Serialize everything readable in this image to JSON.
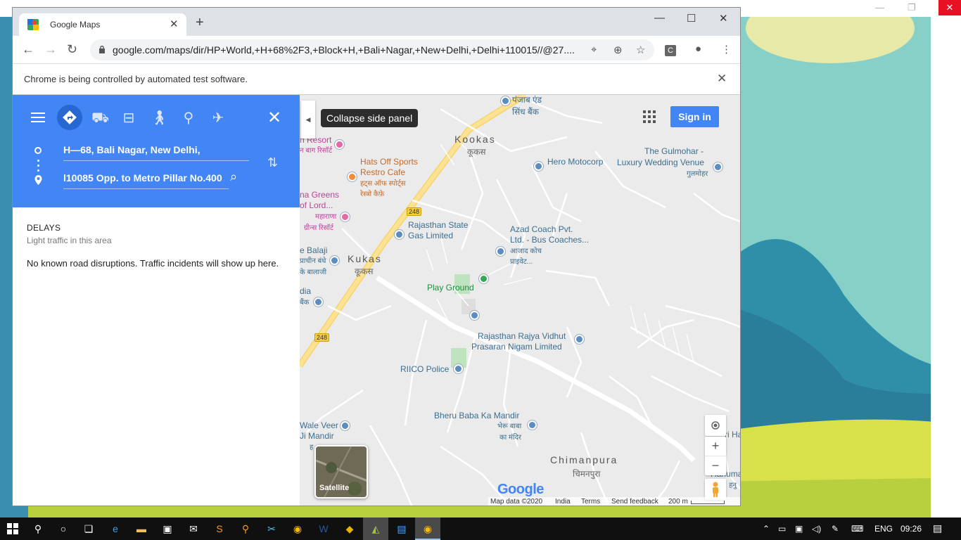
{
  "browser": {
    "tab_title": "Google Maps",
    "url": "google.com/maps/dir/HP+World,+H+68%2F3,+Block+H,+Bali+Nagar,+New+Delhi,+Delhi+110015//@27....",
    "extension_label": "C",
    "infobar_message": "Chrome is being controlled by automated test software.",
    "icons": {
      "back": "arrow-left-icon",
      "forward": "arrow-right-icon",
      "reload": "reload-icon",
      "lock": "lock-icon",
      "star": "star-icon",
      "profile": "account-icon",
      "menu": "kebab-menu-icon"
    }
  },
  "directions": {
    "origin": "H—68, Bali Nagar, New Delhi,",
    "destination": "l10085 Opp. to Metro Pillar No.400",
    "travel_modes": [
      "best-route",
      "driving",
      "transit",
      "walking",
      "cycling",
      "flight"
    ],
    "active_mode": "best-route"
  },
  "delays": {
    "heading": "DELAYS",
    "subheading": "Light traffic in this area",
    "message": "No known road disruptions. Traffic incidents will show up here."
  },
  "map": {
    "tooltip": "Collapse side panel",
    "signin_label": "Sign in",
    "satellite_label": "Satellite",
    "google_logo": "Google",
    "road_number": "248",
    "labels": {
      "kookas": "Kookas",
      "kookas_hi": "कूकस",
      "kukas": "Kukas",
      "kukas_hi": "कूकस",
      "chimanpura": "Chimanpura",
      "chimanpura_hi": "चिमनपुरा",
      "punjab": "पंजाब एंड",
      "sindh": "सिंध बैंक",
      "resort": "n Resort",
      "resort_hi": "न बाग रिसॉर्ट",
      "hats1": "Hats Off Sports",
      "hats2": "Restro Cafe",
      "hats_hi1": "हट्स ऑफ स्पोर्ट्स",
      "hats_hi2": "रेस्त्रो कैफ़े",
      "greens1": "na Greens",
      "greens2": "of Lord...",
      "greens_hi1": "महाराणा",
      "greens_hi2": "ग्रीन्स रिसॉर्ट",
      "hero": "Hero Motocorp",
      "gulmohar1": "The Gulmohar -",
      "gulmohar2": "Luxury Wedding Venue",
      "gulmohar_hi": "गुलमोहर",
      "rsgl1": "Rajasthan State",
      "rsgl2": "Gas Limited",
      "azad1": "Azad Coach Pvt.",
      "azad2": "Ltd. - Bus Coaches...",
      "azad_hi1": "आजाद कोच",
      "azad_hi2": "प्राइवेट...",
      "balaji1": "e Balaji",
      "balaji_hi1": "प्राचीन बंधे",
      "balaji_hi2": "के बालाजी",
      "playground": "Play Ground",
      "india1": "dia",
      "india_hi": "बैंक",
      "rrvpnl1": "Rajasthan Rajya Vidhut",
      "rrvpnl2": "Prasaran Nigam Limited",
      "riico": "RIICO Police",
      "bheru": "Bheru Baba Ka Mandir",
      "bheru_hi1": "भेरू बाबा",
      "bheru_hi2": "का मंदिर",
      "waleveer1": "Wale Veer",
      "waleveer2": "Ji Mandir",
      "waleveer_hi": "ह",
      "hanuman1": "Hanuman J",
      "hanuman_hi": "हनु",
      "shri": "ri Ha"
    },
    "footer": {
      "map_data": "Map data ©2020",
      "country": "India",
      "terms": "Terms",
      "feedback": "Send feedback",
      "scale": "200 m"
    }
  },
  "taskbar": {
    "language": "ENG",
    "time": "09:26"
  },
  "colors": {
    "maps_blue": "#4285f4",
    "chrome_tabbar": "#dee1e6",
    "taskbar": "#101010"
  }
}
